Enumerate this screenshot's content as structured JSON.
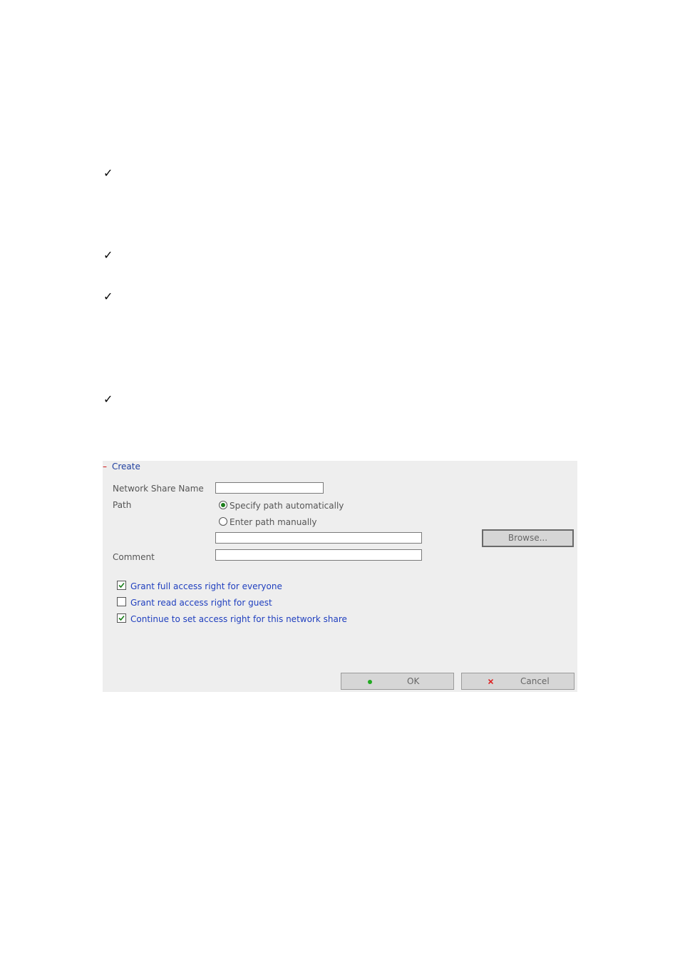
{
  "document": {
    "bullets": [
      "✓",
      "✓",
      "✓",
      "✓"
    ]
  },
  "dialog": {
    "collapse_glyph": "–",
    "title": "Create",
    "fields": {
      "share_name_label": "Network Share Name",
      "share_name_value": "",
      "path_label": "Path",
      "path_auto_label": "Specify path automatically",
      "path_manual_label": "Enter path manually",
      "path_value": "",
      "browse_label": "Browse...",
      "comment_label": "Comment",
      "comment_value": ""
    },
    "path_selected": "auto",
    "options": [
      {
        "label": "Grant full access right for everyone",
        "checked": true
      },
      {
        "label": "Grant read access right for guest",
        "checked": false
      },
      {
        "label": "Continue to set access right for this network share",
        "checked": true
      }
    ],
    "buttons": {
      "ok_label": "OK",
      "ok_icon": "green-dot-icon",
      "ok_icon_color": "#22aa22",
      "cancel_label": "Cancel",
      "cancel_icon": "red-x-icon",
      "cancel_icon_color": "#dd2222"
    }
  }
}
